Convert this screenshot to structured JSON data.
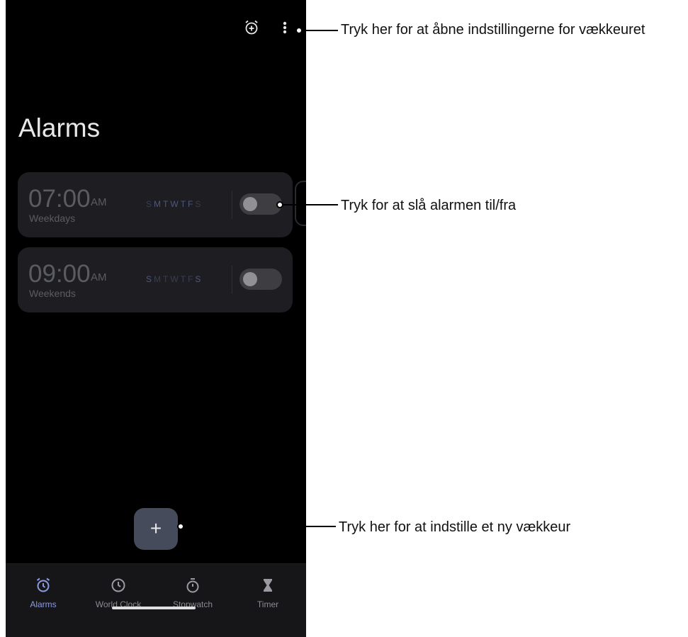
{
  "title": "Alarms",
  "alarms": [
    {
      "time": "07:00",
      "ampm": "AM",
      "label": "Weekdays",
      "days": [
        "S",
        "M",
        "T",
        "W",
        "T",
        "F",
        "S"
      ],
      "active_days": [
        false,
        true,
        true,
        true,
        true,
        true,
        false
      ],
      "enabled": false
    },
    {
      "time": "09:00",
      "ampm": "AM",
      "label": "Weekends",
      "days": [
        "S",
        "M",
        "T",
        "W",
        "T",
        "F",
        "S"
      ],
      "active_days": [
        true,
        false,
        false,
        false,
        false,
        false,
        true
      ],
      "enabled": false
    }
  ],
  "fab_label": "+",
  "nav": {
    "alarms": "Alarms",
    "world_clock": "World Clock",
    "stopwatch": "Stopwatch",
    "timer": "Timer"
  },
  "callouts": {
    "settings": "Tryk her for at åbne indstillingerne for vækkeuret",
    "toggle": "Tryk for at slå alarmen til/fra",
    "add": "Tryk her for at indstille et ny vækkeur"
  },
  "colors": {
    "accent": "#8b9be3",
    "background": "#000000",
    "card": "#1e1e22",
    "fab": "#464b5c"
  }
}
